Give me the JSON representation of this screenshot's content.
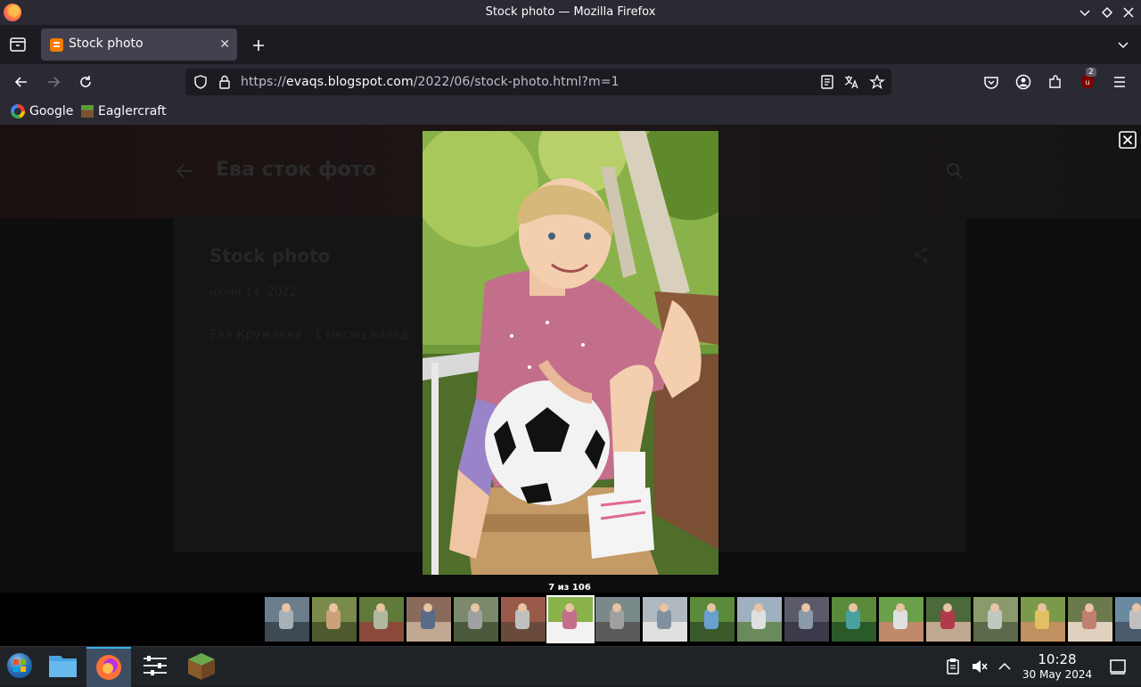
{
  "window": {
    "title": "Stock photo — Mozilla Firefox"
  },
  "tabs": [
    {
      "label": "Stock photo"
    }
  ],
  "urlbar": {
    "prefix": "https://",
    "domain": "evaqs.blogspot.com",
    "path": "/2022/06/stock-photo.html?m=1"
  },
  "bookmarks": [
    {
      "label": "Google"
    },
    {
      "label": "Eaglercraft"
    }
  ],
  "toolbar": {
    "extension_badge": "2"
  },
  "page": {
    "blog_title": "Ева сток фото",
    "post_title": "Stock photo",
    "post_date": "июня 14, 2022",
    "post_meta": "Ева Кружаева · 1 месяц назад"
  },
  "lightbox": {
    "counter": "7 из 106",
    "active_index": 6,
    "thumbnail_count": 19
  },
  "taskbar": {
    "time": "10:28",
    "date": "30 May 2024"
  },
  "colors": {
    "accent": "#3daee9",
    "blogger": "#f57d00",
    "firefox": "#ff7139",
    "tab_bg": "#42414d"
  }
}
